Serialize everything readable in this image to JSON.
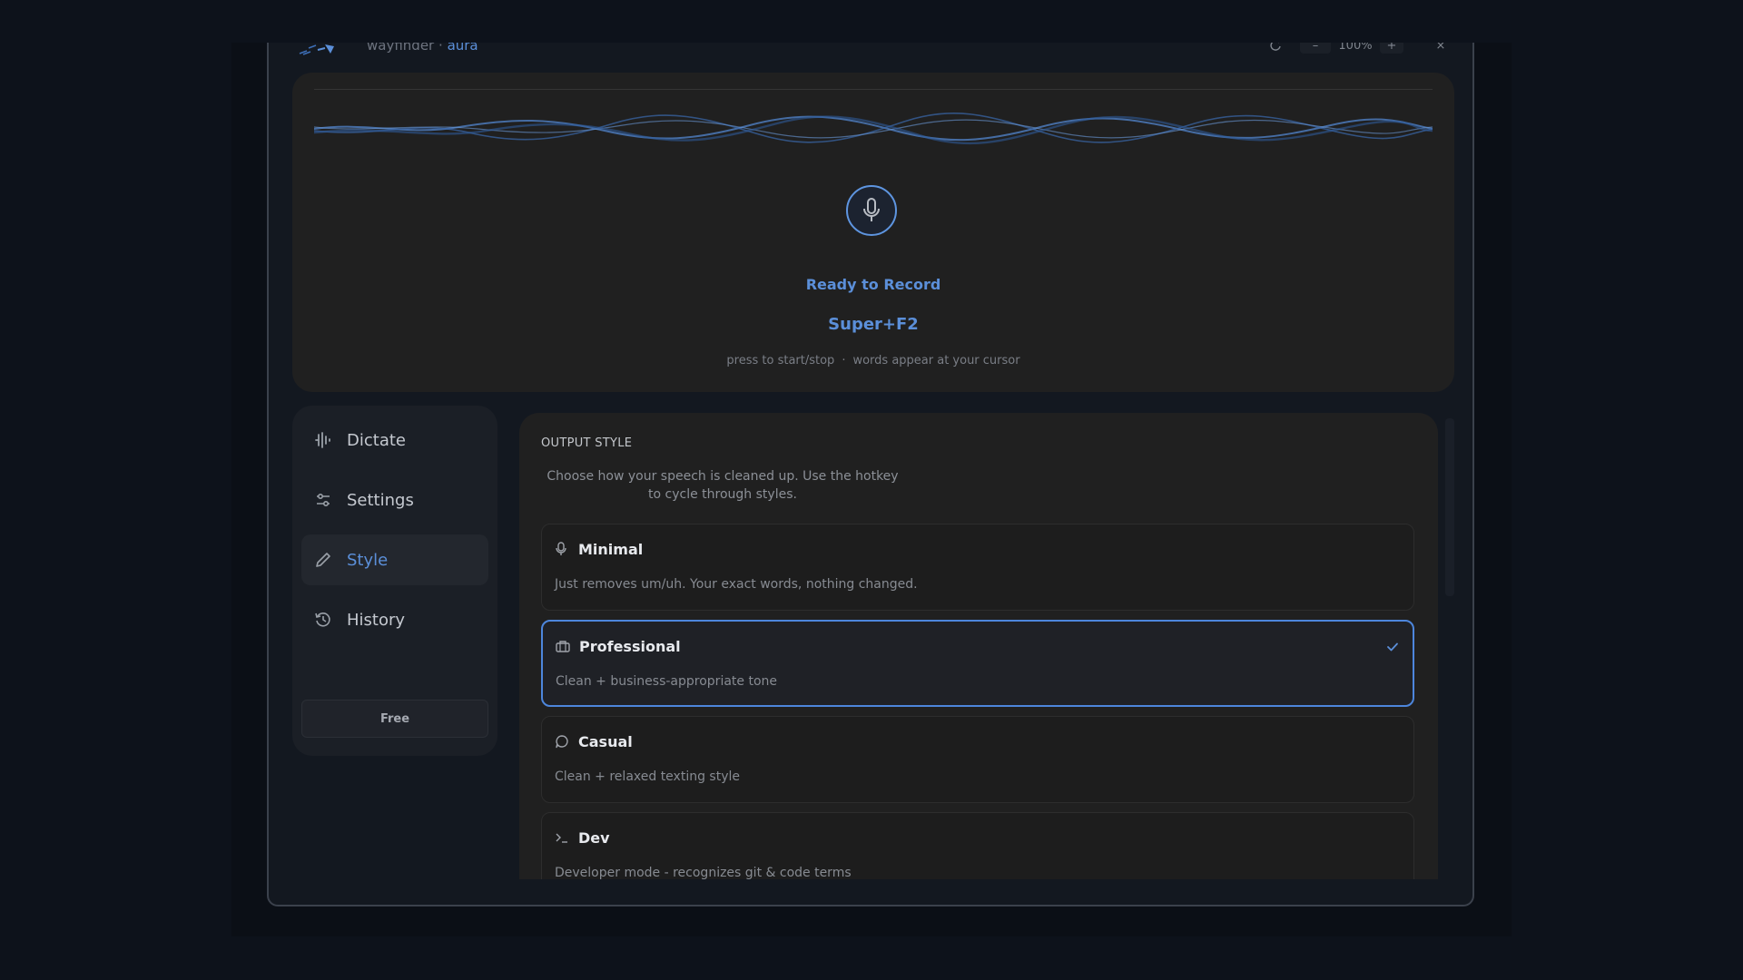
{
  "titlebar": {
    "app_name": "wayfinder",
    "separator": "·",
    "product": "aura",
    "zoom": "100%",
    "minus": "–",
    "plus": "+",
    "close": "×"
  },
  "record": {
    "status": "Ready to Record",
    "hotkey": "Super+F2",
    "hint_left": "press to start/stop",
    "hint_sep": "·",
    "hint_right": "words appear at your cursor"
  },
  "sidebar": {
    "items": [
      {
        "label": "Dictate",
        "icon": "waveform-icon"
      },
      {
        "label": "Settings",
        "icon": "sliders-icon"
      },
      {
        "label": "Style",
        "icon": "pen-icon",
        "active": true
      },
      {
        "label": "History",
        "icon": "history-icon"
      }
    ],
    "plan": "Free"
  },
  "main": {
    "section_label": "OUTPUT STYLE",
    "section_desc": "Choose how your speech is cleaned up. Use the hotkey to cycle through styles.",
    "styles": [
      {
        "title": "Minimal",
        "desc": "Just removes um/uh. Your exact words, nothing changed.",
        "icon": "mic-icon"
      },
      {
        "title": "Professional",
        "desc": "Clean + business-appropriate tone",
        "icon": "briefcase-icon",
        "selected": true
      },
      {
        "title": "Casual",
        "desc": "Clean + relaxed texting style",
        "icon": "chat-bubble-icon"
      },
      {
        "title": "Dev",
        "desc": "Developer mode - recognizes git & code terms",
        "icon": "terminal-icon"
      }
    ]
  },
  "colors": {
    "accent": "#5b8fd9",
    "panel": "#202020",
    "background": "#0d121b"
  }
}
